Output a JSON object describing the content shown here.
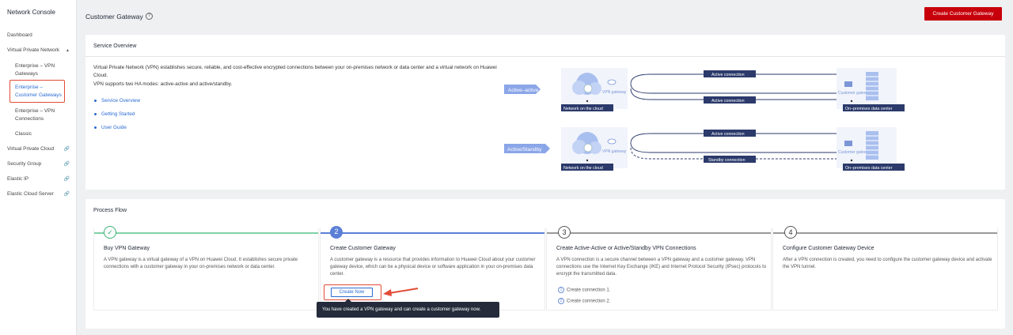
{
  "sidebar": {
    "title": "Network Console",
    "dashboard": "Dashboard",
    "vpn_group": "Virtual Private Network",
    "sub_items": [
      {
        "label": "Enterprise – VPN Gateways"
      },
      {
        "label": "Enterprise – Customer Gateways"
      },
      {
        "label": "Enterprise – VPN Connections"
      },
      {
        "label": "Classic"
      }
    ],
    "items": [
      {
        "label": "Virtual Private Cloud"
      },
      {
        "label": "Security Group"
      },
      {
        "label": "Elastic IP"
      },
      {
        "label": "Elastic Cloud Server"
      }
    ]
  },
  "header": {
    "title": "Customer Gateway",
    "create_button": "Create Customer Gateway"
  },
  "overview": {
    "title": "Service Overview",
    "description": "Virtual Private Network (VPN) establishes secure, reliable, and cost-effective encrypted connections between your on-premises network or data center and a virtual network on Huawei Cloud.",
    "ha_modes": "VPN supports two HA modes: active-active and active/standby.",
    "links": [
      "Service Overview",
      "Getting Started",
      "User Guide"
    ],
    "diagram": {
      "row1_mode": "Active–active",
      "row2_mode": "Active/Standby",
      "vpn_gateway": "VPN gateway",
      "network_on_cloud": "Network on the cloud",
      "customer_gateway": "Customer gateway",
      "on_premises": "On–premises data center",
      "active_connection": "Active connection",
      "standby_connection": "Standby connection"
    }
  },
  "process": {
    "title": "Process Flow",
    "steps": [
      {
        "num": "✓",
        "title": "Buy VPN Gateway",
        "desc": "A VPN gateway is a virtual gateway of a VPN on Huawei Cloud. It establishes secure private connections with a customer gateway in your on-premises network or data center."
      },
      {
        "num": "2",
        "title": "Create Customer Gateway",
        "desc": "A customer gateway is a resource that provides information to Huawei Cloud about your customer gateway device, which can be a physical device or software application in your on-premises data center."
      },
      {
        "num": "3",
        "title": "Create Active-Active or Active/Standby VPN Connections",
        "desc": "A VPN connection is a secure channel between a VPN gateway and a customer gateway. VPN connections use the Internet Key Exchange (IKE) and Internet Protocol Security (IPsec) protocols to encrypt the transmitted data."
      },
      {
        "num": "4",
        "title": "Configure Customer Gateway Device",
        "desc": "After a VPN connection is created, you need to configure the customer gateway device and activate the VPN tunnel."
      }
    ],
    "step3_list": [
      "Create connection 1.",
      "Create connection 2."
    ],
    "create_now": "Create Now",
    "tooltip": "You have created a VPN gateway and can create a customer gateway now."
  },
  "colors": {
    "brand_red": "#c7000b",
    "link_blue": "#2a6bd1",
    "done_green": "#3bb273",
    "step_blue": "#5b7fd6"
  }
}
